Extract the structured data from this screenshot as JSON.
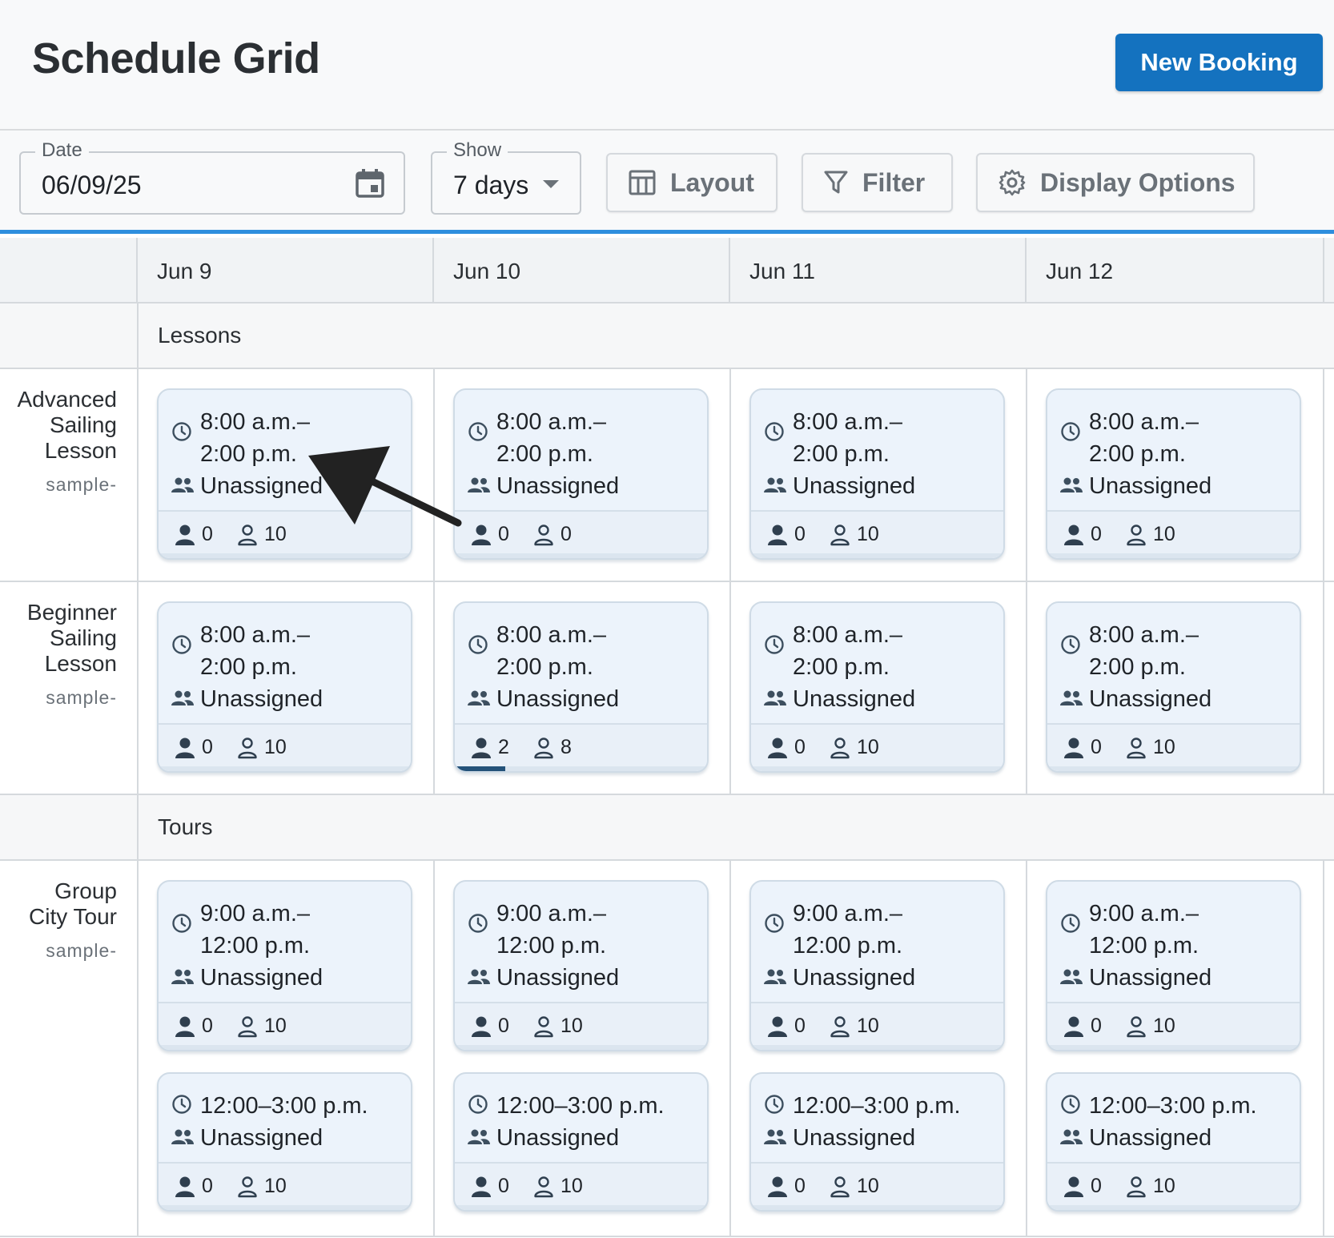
{
  "header": {
    "title": "Schedule Grid",
    "new_booking_label": "New Booking"
  },
  "toolbar": {
    "date": {
      "label": "Date",
      "value": "06/09/25"
    },
    "show": {
      "label": "Show",
      "value": "7 days"
    },
    "layout_label": "Layout",
    "filter_label": "Filter",
    "display_options_label": "Display Options"
  },
  "grid": {
    "dates": [
      "Jun 9",
      "Jun 10",
      "Jun 11",
      "Jun 12"
    ],
    "sections": [
      {
        "name": "Lessons",
        "rows": [
          {
            "name": "Advanced Sailing Lesson",
            "name_lines": [
              "Advanced",
              "Sailing",
              "Lesson"
            ],
            "sub": "sample-",
            "slots": [
              [
                {
                  "time_lines": [
                    "8:00 a.m.–",
                    "2:00 p.m."
                  ],
                  "staff": "Unassigned",
                  "booked": "0",
                  "available": "10",
                  "fill": 0
                }
              ],
              [
                {
                  "time_lines": [
                    "8:00 a.m.–",
                    "2:00 p.m."
                  ],
                  "staff": "Unassigned",
                  "booked": "0",
                  "available": "0",
                  "fill": 0
                }
              ],
              [
                {
                  "time_lines": [
                    "8:00 a.m.–",
                    "2:00 p.m."
                  ],
                  "staff": "Unassigned",
                  "booked": "0",
                  "available": "10",
                  "fill": 0
                }
              ],
              [
                {
                  "time_lines": [
                    "8:00 a.m.–",
                    "2:00 p.m."
                  ],
                  "staff": "Unassigned",
                  "booked": "0",
                  "available": "10",
                  "fill": 0
                }
              ]
            ]
          },
          {
            "name": "Beginner Sailing Lesson",
            "name_lines": [
              "Beginner",
              "Sailing",
              "Lesson"
            ],
            "sub": "sample-",
            "slots": [
              [
                {
                  "time_lines": [
                    "8:00 a.m.–",
                    "2:00 p.m."
                  ],
                  "staff": "Unassigned",
                  "booked": "0",
                  "available": "10",
                  "fill": 0
                }
              ],
              [
                {
                  "time_lines": [
                    "8:00 a.m.–",
                    "2:00 p.m."
                  ],
                  "staff": "Unassigned",
                  "booked": "2",
                  "available": "8",
                  "fill": 0.2
                }
              ],
              [
                {
                  "time_lines": [
                    "8:00 a.m.–",
                    "2:00 p.m."
                  ],
                  "staff": "Unassigned",
                  "booked": "0",
                  "available": "10",
                  "fill": 0
                }
              ],
              [
                {
                  "time_lines": [
                    "8:00 a.m.–",
                    "2:00 p.m."
                  ],
                  "staff": "Unassigned",
                  "booked": "0",
                  "available": "10",
                  "fill": 0
                }
              ]
            ]
          }
        ]
      },
      {
        "name": "Tours",
        "rows": [
          {
            "name": "Group City Tour",
            "name_lines": [
              "Group",
              "City Tour"
            ],
            "sub": "sample-",
            "slots": [
              [
                {
                  "time_lines": [
                    "9:00 a.m.–",
                    "12:00 p.m."
                  ],
                  "staff": "Unassigned",
                  "booked": "0",
                  "available": "10",
                  "fill": 0
                },
                {
                  "time_lines": [
                    "12:00–3:00 p.m."
                  ],
                  "staff": "Unassigned",
                  "booked": "0",
                  "available": "10",
                  "fill": 0
                }
              ],
              [
                {
                  "time_lines": [
                    "9:00 a.m.–",
                    "12:00 p.m."
                  ],
                  "staff": "Unassigned",
                  "booked": "0",
                  "available": "10",
                  "fill": 0
                },
                {
                  "time_lines": [
                    "12:00–3:00 p.m."
                  ],
                  "staff": "Unassigned",
                  "booked": "0",
                  "available": "10",
                  "fill": 0
                }
              ],
              [
                {
                  "time_lines": [
                    "9:00 a.m.–",
                    "12:00 p.m."
                  ],
                  "staff": "Unassigned",
                  "booked": "0",
                  "available": "10",
                  "fill": 0
                },
                {
                  "time_lines": [
                    "12:00–3:00 p.m."
                  ],
                  "staff": "Unassigned",
                  "booked": "0",
                  "available": "10",
                  "fill": 0
                }
              ],
              [
                {
                  "time_lines": [
                    "9:00 a.m.–",
                    "12:00 p.m."
                  ],
                  "staff": "Unassigned",
                  "booked": "0",
                  "available": "10",
                  "fill": 0
                },
                {
                  "time_lines": [
                    "12:00–3:00 p.m."
                  ],
                  "staff": "Unassigned",
                  "booked": "0",
                  "available": "10",
                  "fill": 0
                }
              ]
            ]
          }
        ]
      }
    ]
  },
  "colors": {
    "accent": "#1472bf",
    "toolbar_underline": "#2e8ede",
    "card_bg": "#ecf3fb",
    "progress_fill": "#24527a"
  },
  "icons": {
    "date_field": "calendar-icon",
    "show_field": "caret-down-icon",
    "layout": "table-layout-icon",
    "filter": "funnel-icon",
    "display_options": "gear-icon",
    "time": "clock-icon",
    "staff": "group-icon",
    "booked": "person-filled-icon",
    "available": "person-outline-icon",
    "annotation": "arrow-pointer-icon"
  }
}
